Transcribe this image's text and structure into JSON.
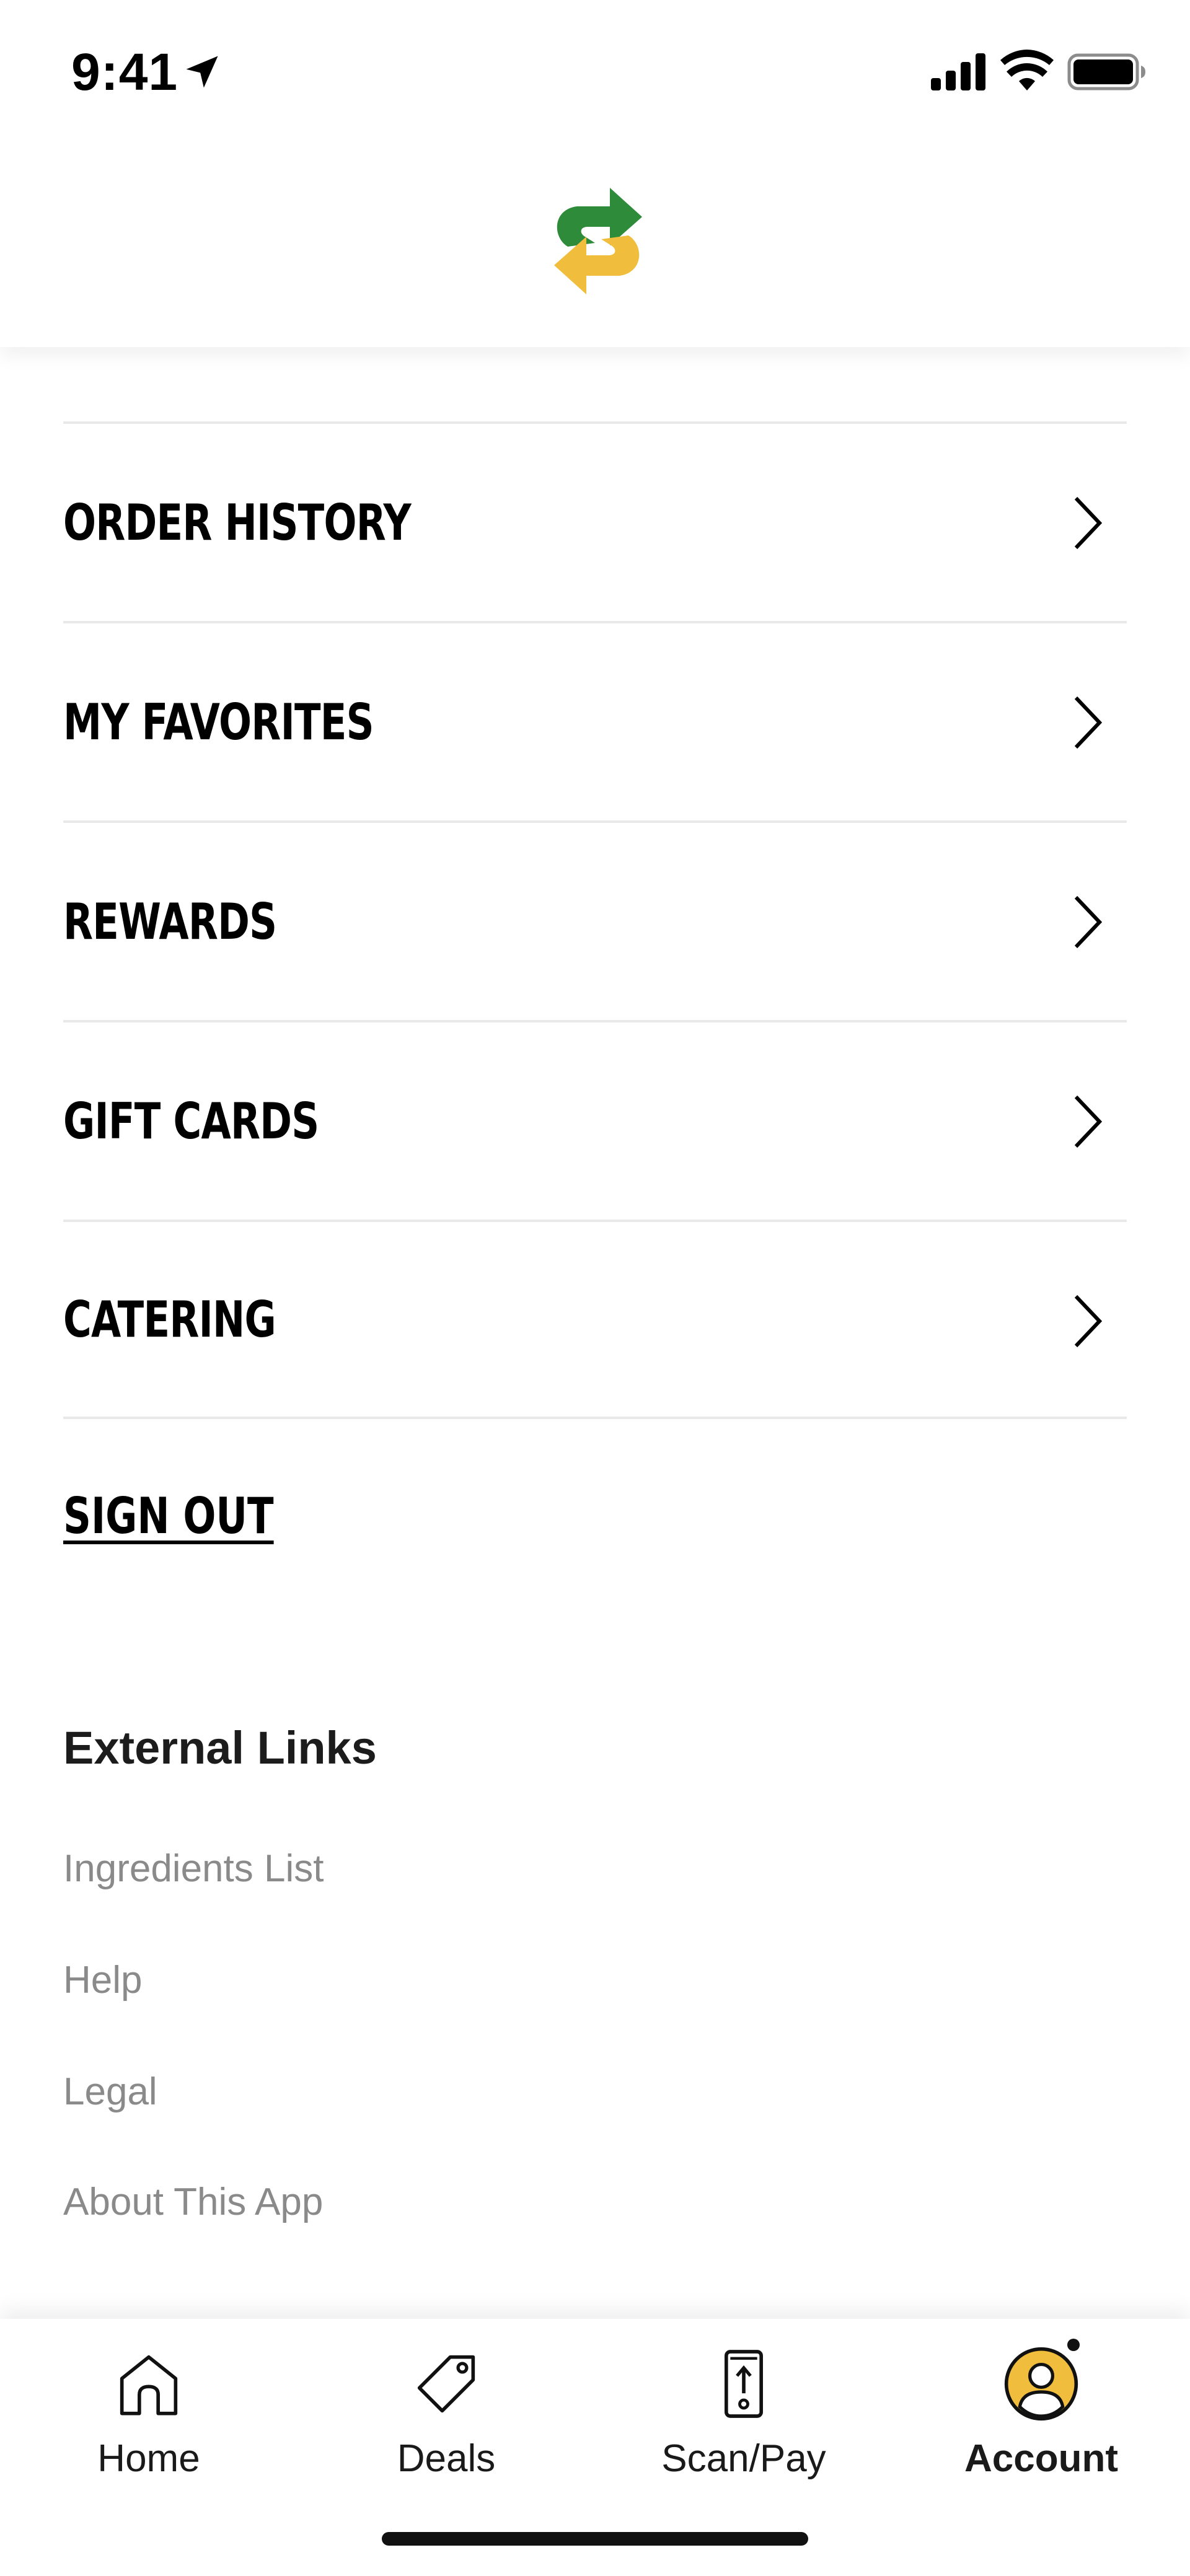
{
  "status_bar": {
    "time": "9:41"
  },
  "menu": {
    "items": [
      {
        "label": "ORDER HISTORY"
      },
      {
        "label": "MY FAVORITES"
      },
      {
        "label": "REWARDS"
      },
      {
        "label": "GIFT CARDS"
      },
      {
        "label": "CATERING"
      }
    ],
    "sign_out": "SIGN OUT"
  },
  "external_links": {
    "title": "External Links",
    "links": [
      {
        "label": "Ingredients List"
      },
      {
        "label": "Help"
      },
      {
        "label": "Legal"
      },
      {
        "label": "About This App"
      }
    ]
  },
  "tabbar": {
    "tabs": [
      {
        "label": "Home",
        "icon": "home-icon"
      },
      {
        "label": "Deals",
        "icon": "tag-icon"
      },
      {
        "label": "Scan/Pay",
        "icon": "phone-scan-icon"
      },
      {
        "label": "Account",
        "icon": "account-avatar-icon",
        "active": true
      }
    ]
  },
  "colors": {
    "brand_green": "#2e8b3a",
    "brand_yellow": "#f0bd3c",
    "divider": "#e9e9e9",
    "link_gray": "#8a8a8a"
  }
}
